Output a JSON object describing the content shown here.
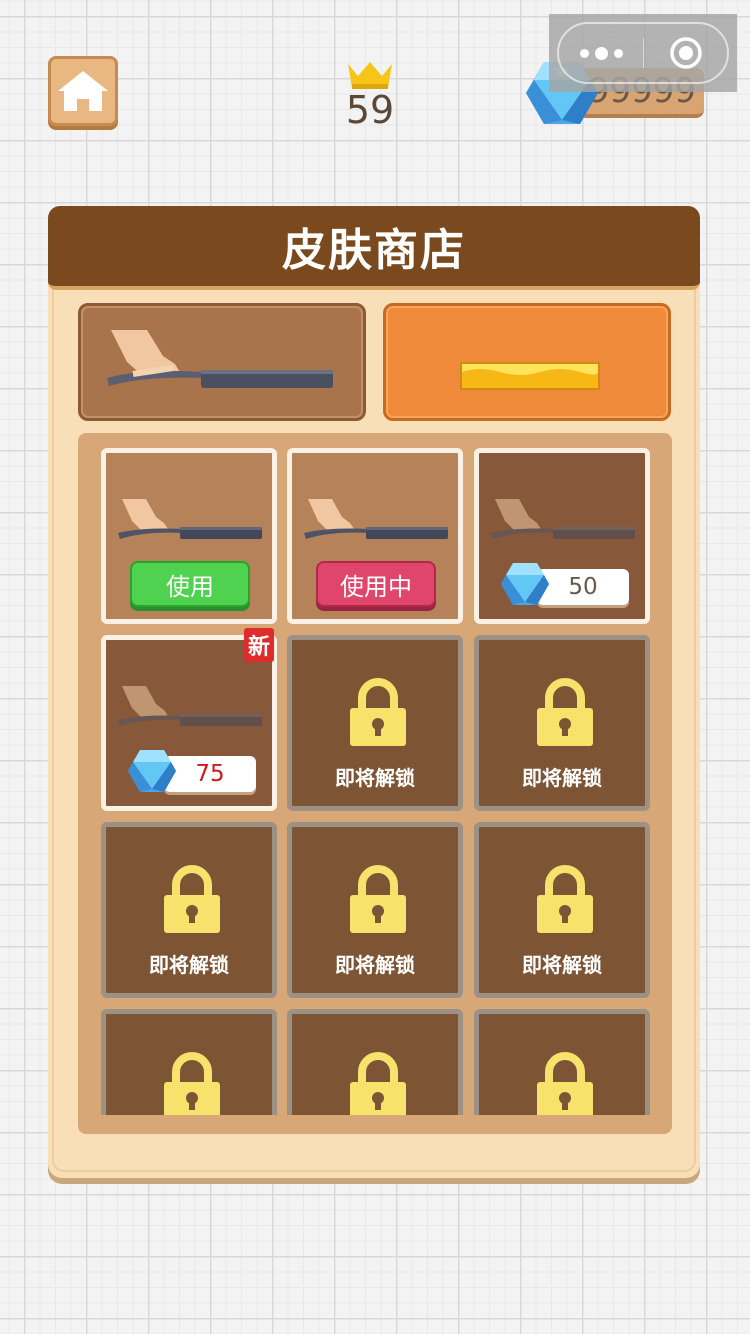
{
  "top_bar": {
    "home_icon": "home-icon",
    "level_icon": "crown-icon",
    "level": "59",
    "gem_icon": "diamond-icon",
    "gems": "99999",
    "capsule": {
      "more_icon": "more-dots-icon",
      "close_icon": "target-circle-icon"
    }
  },
  "panel": {
    "title": "皮肤商店",
    "tabs": [
      {
        "name": "pan",
        "icon": "frying-pan-icon",
        "active": false
      },
      {
        "name": "other",
        "icon": "golden-bar-icon",
        "active": true
      }
    ]
  },
  "items": [
    {
      "state": "owned",
      "action": "使用"
    },
    {
      "state": "in_use",
      "action": "使用中"
    },
    {
      "state": "buyable",
      "price": "50"
    },
    {
      "state": "buyable",
      "price": "75",
      "badge": "新"
    },
    {
      "state": "locked",
      "label": "即将解锁"
    },
    {
      "state": "locked",
      "label": "即将解锁"
    },
    {
      "state": "locked",
      "label": "即将解锁"
    },
    {
      "state": "locked",
      "label": "即将解锁"
    },
    {
      "state": "locked",
      "label": "即将解锁"
    },
    {
      "state": "locked",
      "label": "即将解锁"
    },
    {
      "state": "locked",
      "label": "即将解锁"
    },
    {
      "state": "locked",
      "label": "即将解锁"
    }
  ],
  "colors": {
    "header_brown": "#7a4a1e",
    "panel_bg": "#f8dfb8",
    "use_green": "#4fd24f",
    "in_use_pink": "#e0466b",
    "lock_yellow": "#f7e26b",
    "price_red": "#d4171c"
  }
}
